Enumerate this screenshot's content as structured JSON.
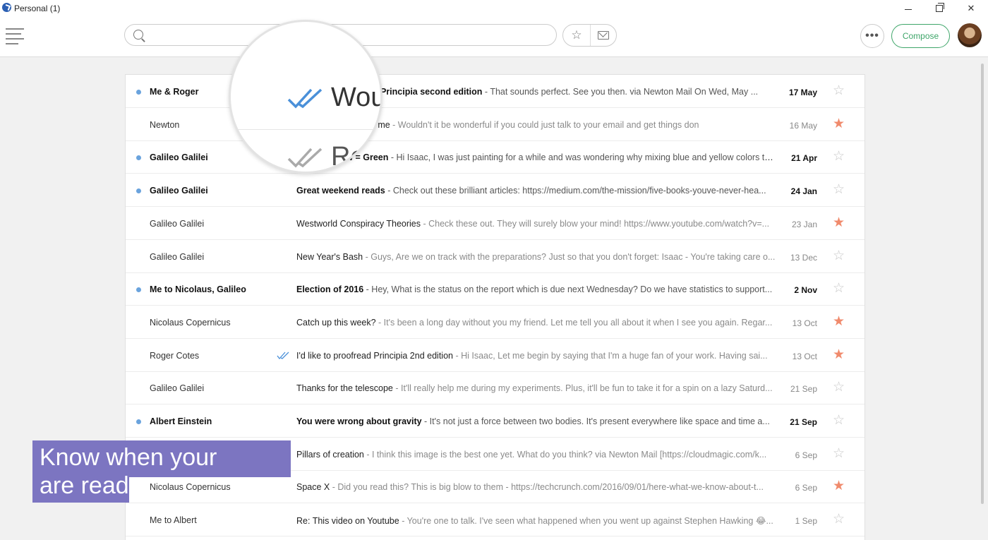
{
  "window": {
    "title": "Personal (1)",
    "min": "",
    "max": "",
    "close": "✕"
  },
  "toolbar": {
    "search_placeholder": "",
    "compose_label": "Compose",
    "more_label": "•••"
  },
  "magnifier": {
    "word1": "Wou",
    "word2": "Re"
  },
  "promo": {
    "line1": "Know when your emails",
    "line2": "are read"
  },
  "colors": {
    "accent": "#3fa66a",
    "unread_dot": "#6aa3dd",
    "star_filled": "#f08a6c",
    "promo_bg": "#7c75c1",
    "read_tick": "#4a90d9"
  },
  "emails": [
    {
      "sender": "Me & Roger",
      "subject": "I'd like to proofread Principia second edition",
      "snippet": " - That sounds perfect. See you then. via Newton Mail On Wed, May ...",
      "date": "17 May",
      "unread": true,
      "starred": false,
      "read_receipt": false
    },
    {
      "sender": "Newton",
      "subject": "Re: Who just mailed me",
      "snippet": " - Wouldn't it be wonderful if you could just talk to your email and get things don",
      "date": "16 May",
      "unread": false,
      "starred": true,
      "read_receipt": false
    },
    {
      "sender": "Galileo Galilei",
      "subject": "Blue + Yellow = Green",
      "snippet": " - Hi Isaac, I was just painting for a while and was wondering why mixing blue and yellow colors to...",
      "date": "21 Apr",
      "unread": true,
      "starred": false,
      "read_receipt": false
    },
    {
      "sender": "Galileo Galilei",
      "subject": "Great weekend reads",
      "snippet": " - Check out these brilliant articles: https://medium.com/the-mission/five-books-youve-never-hea...",
      "date": "24 Jan",
      "unread": true,
      "starred": false,
      "read_receipt": false
    },
    {
      "sender": "Galileo Galilei",
      "subject": "Westworld Conspiracy Theories",
      "snippet": " - Check these out. They will surely blow your mind! https://www.youtube.com/watch?v=...",
      "date": "23 Jan",
      "unread": false,
      "starred": true,
      "read_receipt": false
    },
    {
      "sender": "Galileo Galilei",
      "subject": "New Year's Bash",
      "snippet": " - Guys, Are we on track with the preparations? Just so that you don't forget: Isaac - You're taking care o...",
      "date": "13 Dec",
      "unread": false,
      "starred": false,
      "read_receipt": false
    },
    {
      "sender": "Me to Nicolaus, Galileo",
      "subject": "Election of 2016",
      "snippet": " - Hey, What is the status on the report which is due next Wednesday? Do we have statistics to support...",
      "date": "2 Nov",
      "unread": true,
      "starred": false,
      "read_receipt": false
    },
    {
      "sender": "Nicolaus Copernicus",
      "subject": "Catch up this week?",
      "snippet": " - It's been a long day without you my friend. Let me tell you all about it when I see you again. Regar...",
      "date": "13 Oct",
      "unread": false,
      "starred": true,
      "read_receipt": false
    },
    {
      "sender": "Roger Cotes",
      "subject": "I'd like to proofread Principia 2nd edition",
      "snippet": " - Hi Isaac, Let me begin by saying that I'm a huge fan of your work. Having sai...",
      "date": "13 Oct",
      "unread": false,
      "starred": true,
      "read_receipt": true
    },
    {
      "sender": "Galileo Galilei",
      "subject": "Thanks for the telescope",
      "snippet": " - It'll really help me during my experiments. Plus, it'll be fun to take it for a spin on a lazy Saturd...",
      "date": "21 Sep",
      "unread": false,
      "starred": false,
      "read_receipt": false
    },
    {
      "sender": "Albert Einstein",
      "subject": "You were wrong about gravity",
      "snippet": " - It's not just a force between two bodies. It's present everywhere like space and time a...",
      "date": "21 Sep",
      "unread": true,
      "starred": false,
      "read_receipt": false
    },
    {
      "sender": "",
      "subject": "Pillars of creation",
      "snippet": " - I think this image is the best one yet. What do you think? via Newton Mail [https://cloudmagic.com/k...",
      "date": "6 Sep",
      "unread": false,
      "starred": false,
      "read_receipt": false
    },
    {
      "sender": "Nicolaus Copernicus",
      "subject": "Space X",
      "snippet": " - Did you read this? This is big blow to them - https://techcrunch.com/2016/09/01/here-what-we-know-about-t...",
      "date": "6 Sep",
      "unread": false,
      "starred": true,
      "read_receipt": false
    },
    {
      "sender": "Me to Albert",
      "subject": "Re: This video on Youtube",
      "snippet": " - You're one to talk. I've seen what happened when you went up against Stephen Hawking 😂...",
      "date": "1 Sep",
      "unread": false,
      "starred": false,
      "read_receipt": false
    }
  ]
}
